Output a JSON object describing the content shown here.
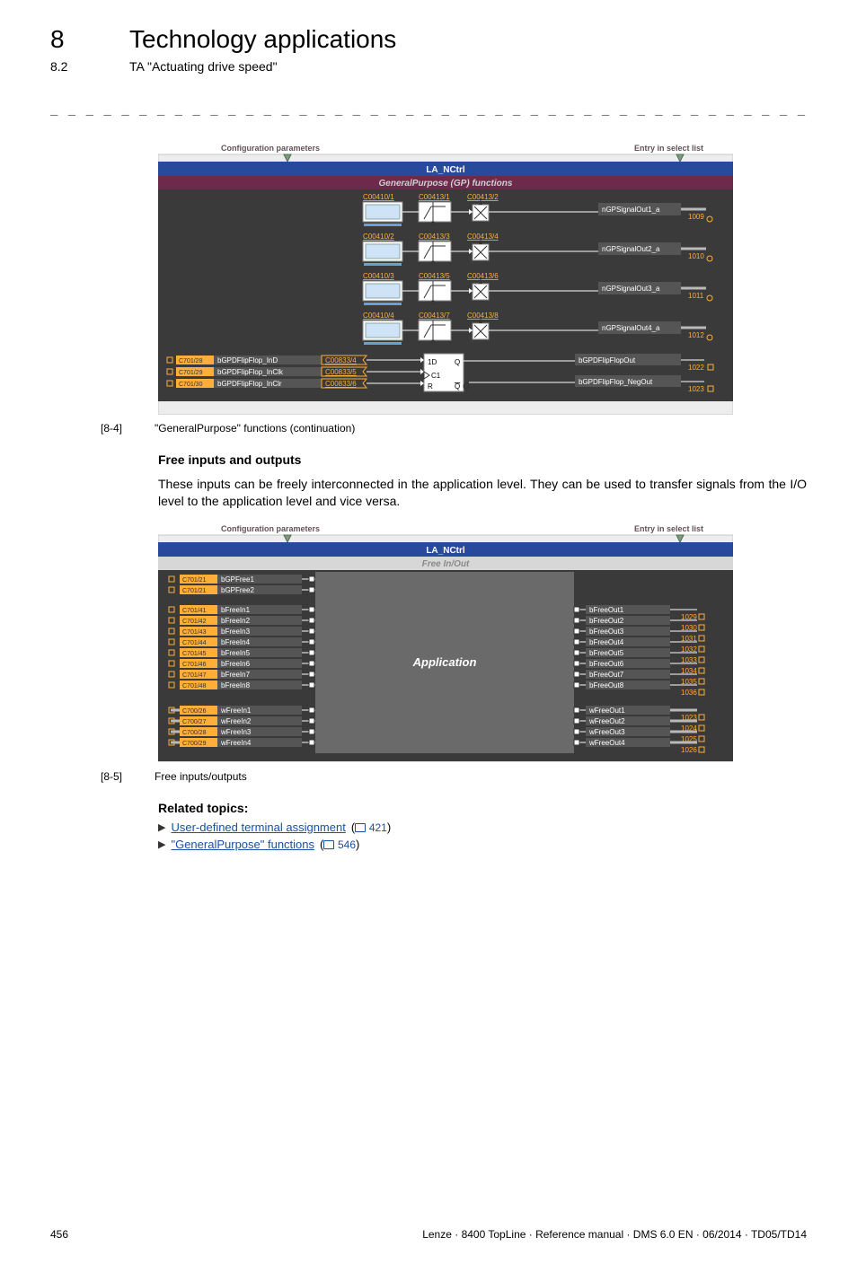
{
  "header": {
    "chapter_num": "8",
    "chapter_title": "Technology applications",
    "section_num": "8.2",
    "section_title": "TA \"Actuating drive speed\""
  },
  "dash_rule": "_ _ _ _ _ _ _ _ _ _ _ _ _ _ _ _ _ _ _ _ _ _ _ _ _ _ _ _ _ _ _ _ _ _ _ _ _ _ _ _ _ _ _ _ _ _ _ _ _ _ _ _ _ _ _ _ _ _ _ _ _ _ _ _",
  "diagram1": {
    "left_label": "Configuration parameters",
    "right_label": "Entry in select list",
    "bar_title": "LA_NCtrl",
    "sub_title": "GeneralPurpose (GP) functions",
    "rows": [
      {
        "c1": "C00410/1",
        "c2": "C00413/1",
        "c3": "C00413/2",
        "out": "nGPSignalOut1_a",
        "onum": "1009"
      },
      {
        "c1": "C00410/2",
        "c2": "C00413/3",
        "c3": "C00413/4",
        "out": "nGPSignalOut2_a",
        "onum": "1010"
      },
      {
        "c1": "C00410/3",
        "c2": "C00413/5",
        "c3": "C00413/6",
        "out": "nGPSignalOut3_a",
        "onum": "1011"
      },
      {
        "c1": "C00410/4",
        "c2": "C00413/7",
        "c3": "C00413/8",
        "out": "nGPSignalOut4_a",
        "onum": "1012"
      }
    ],
    "ff": {
      "in": [
        {
          "port": "C701/28",
          "label": "bGPDFlipFlop_InD",
          "code": "C00833/4"
        },
        {
          "port": "C701/29",
          "label": "bGPDFlipFlop_InClk",
          "code": "C00833/5"
        },
        {
          "port": "C701/30",
          "label": "bGPDFlipFlop_InClr",
          "code": "C00833/6"
        }
      ],
      "box": {
        "l1a": "1D",
        "l1b": "Q",
        "l2": "C1",
        "l3a": "R",
        "l3b": "Q"
      },
      "out": [
        {
          "label": "bGPDFlipFlopOut",
          "onum": "1022"
        },
        {
          "label": "bGPDFlipFlop_NegOut",
          "onum": "1023"
        }
      ]
    }
  },
  "caption1": {
    "id": "[8-4]",
    "text": "\"GeneralPurpose\" functions (continuation)"
  },
  "free": {
    "heading": "Free inputs and outputs",
    "para": "These inputs can be freely interconnected in the application level. They can be used to transfer signals from the I/O level to the application level and vice versa."
  },
  "diagram2": {
    "left_label": "Configuration parameters",
    "right_label": "Entry in select list",
    "bar_title": "LA_NCtrl",
    "sub_title": "Free In/Out",
    "app_label": "Application",
    "gp": [
      {
        "port": "C701/21",
        "label": "bGPFree1"
      },
      {
        "port": "C701/21",
        "label": "bGPFree2"
      }
    ],
    "bIn": [
      {
        "port": "C701/41",
        "label": "bFreeIn1"
      },
      {
        "port": "C701/42",
        "label": "bFreeIn2"
      },
      {
        "port": "C701/43",
        "label": "bFreeIn3"
      },
      {
        "port": "C701/44",
        "label": "bFreeIn4"
      },
      {
        "port": "C701/45",
        "label": "bFreeIn5"
      },
      {
        "port": "C701/46",
        "label": "bFreeIn6"
      },
      {
        "port": "C701/47",
        "label": "bFreeIn7"
      },
      {
        "port": "C701/48",
        "label": "bFreeIn8"
      }
    ],
    "bOut": [
      {
        "label": "bFreeOut1",
        "onum": "1029"
      },
      {
        "label": "bFreeOut2",
        "onum": "1030"
      },
      {
        "label": "bFreeOut3",
        "onum": "1031"
      },
      {
        "label": "bFreeOut4",
        "onum": "1032"
      },
      {
        "label": "bFreeOut5",
        "onum": "1033"
      },
      {
        "label": "bFreeOut6",
        "onum": "1034"
      },
      {
        "label": "bFreeOut7",
        "onum": "1035"
      },
      {
        "label": "bFreeOut8",
        "onum": "1036"
      }
    ],
    "wIn": [
      {
        "port": "C700/26",
        "label": "wFreeIn1"
      },
      {
        "port": "C700/27",
        "label": "wFreeIn2"
      },
      {
        "port": "C700/28",
        "label": "wFreeIn3"
      },
      {
        "port": "C700/29",
        "label": "wFreeIn4"
      }
    ],
    "wOut": [
      {
        "label": "wFreeOut1",
        "onum": "1023"
      },
      {
        "label": "wFreeOut2",
        "onum": "1024"
      },
      {
        "label": "wFreeOut3",
        "onum": "1025"
      },
      {
        "label": "wFreeOut4",
        "onum": "1026"
      }
    ]
  },
  "caption2": {
    "id": "[8-5]",
    "text": "Free inputs/outputs"
  },
  "related": {
    "heading": "Related topics:",
    "links": [
      {
        "text": "User-defined terminal assignment",
        "page": "421"
      },
      {
        "text": "\"GeneralPurpose\" functions",
        "page": "546"
      }
    ]
  },
  "footer": {
    "page": "456",
    "right": "Lenze · 8400 TopLine · Reference manual · DMS 6.0 EN · 06/2014 · TD05/TD14"
  }
}
